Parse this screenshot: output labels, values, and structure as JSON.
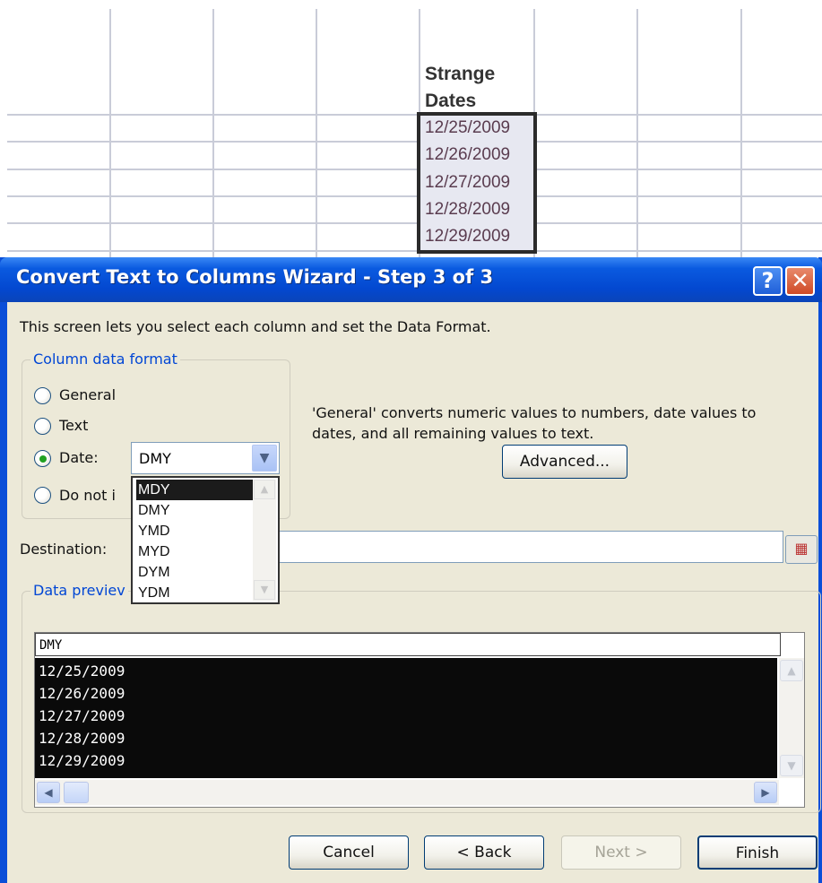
{
  "sheet": {
    "header_line1": "Strange",
    "header_line2": "Dates",
    "dates": [
      "12/25/2009",
      "12/26/2009",
      "12/27/2009",
      "12/28/2009",
      "12/29/2009"
    ]
  },
  "dialog": {
    "title": "Convert Text to Columns Wizard - Step 3 of 3",
    "help_glyph": "?",
    "close_glyph": "✕",
    "intro": "This screen lets you select each column and set the Data Format.",
    "column_format_label": "Column data format",
    "radio_general": "General",
    "radio_text": "Text",
    "radio_date": "Date:",
    "radio_skip": "Do not i",
    "date_select_value": "DMY",
    "date_options": [
      "MDY",
      "DMY",
      "YMD",
      "MYD",
      "DYM",
      "YDM"
    ],
    "description": "'General' converts numeric values to numbers, date values to dates, and all remaining values to text.",
    "advanced_button": "Advanced...",
    "destination_label": "Destination:",
    "data_preview_label": "Data previev",
    "preview_header": "DMY",
    "preview_rows": [
      "12/25/2009",
      "12/26/2009",
      "12/27/2009",
      "12/28/2009",
      "12/29/2009"
    ],
    "cancel_button": "Cancel",
    "back_button": "< Back",
    "next_button": "Next >",
    "finish_button": "Finish"
  },
  "colors": {
    "titlebar": "#0348d0",
    "dialog_bg": "#ece9d8",
    "group_label": "#0046d5",
    "radio_dot": "#21a121"
  }
}
